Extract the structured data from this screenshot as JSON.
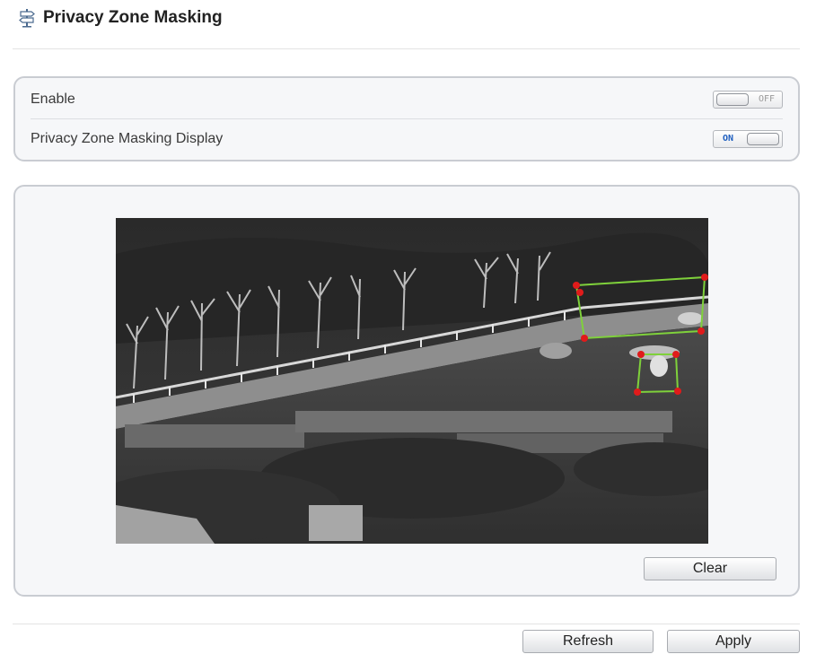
{
  "header": {
    "title": "Privacy Zone Masking",
    "icon": "signpost-icon"
  },
  "settings": {
    "enable": {
      "label": "Enable",
      "state": "OFF"
    },
    "display": {
      "label": "Privacy Zone Masking Display",
      "state": "ON"
    }
  },
  "preview": {
    "type": "thermal-camera-feed",
    "mask_colors": {
      "outline": "#7fd13b",
      "vertex": "#e01b1b"
    }
  },
  "buttons": {
    "clear": "Clear",
    "refresh": "Refresh",
    "apply": "Apply"
  },
  "colors": {
    "panel_border": "#c9ccd2",
    "panel_bg": "#f6f7f9",
    "toggle_on_text": "#1f5fbf"
  }
}
